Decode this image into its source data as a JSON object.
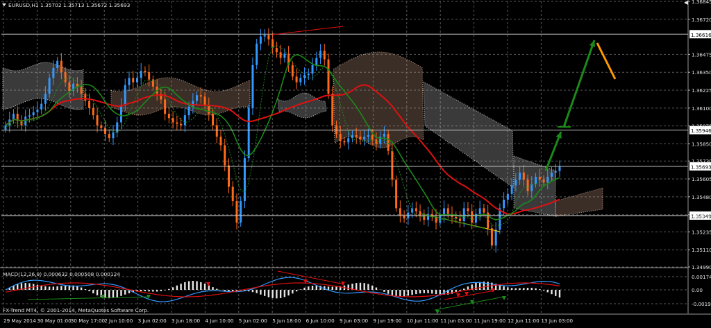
{
  "window": {
    "symbol_label": "EURUSD,H1",
    "ohlc_text": "1.35702 1.35713 1.35672 1.35693",
    "footer_text": "FX-Trend MT4, © 2001-2014, MetaQuotes Software Corp."
  },
  "colors": {
    "background": "#000000",
    "grid": "#5a5a5a",
    "bull_candle": "#3399ff",
    "bear_candle": "#ff6a1a",
    "ma_slow": "#e01010",
    "ma_fast": "#1a8a1a",
    "cloud_a": "#d2a58c",
    "cloud_b": "#cfcfcf",
    "arrow_up": "#1a8a1a",
    "arrow_down": "#ff9a00",
    "sr_line": "#c8c8c8",
    "macd_hist": "#e6e6e6",
    "macd_main": "#3399ff",
    "macd_signal": "#e01010",
    "price_label_bg": "#ffffff"
  },
  "chart_data": {
    "type": "line",
    "title": "EURUSD,H1",
    "y_axis": {
      "range": [
        1.3499,
        1.36845
      ],
      "tick_labels": [
        "1.36845",
        "1.36720",
        "1.36475",
        "1.36350",
        "1.36225",
        "1.36100",
        "1.35975",
        "1.35850",
        "1.35730",
        "1.35605",
        "1.35480",
        "1.35355",
        "1.35235",
        "1.35110",
        "1.34990"
      ]
    },
    "x_axis": {
      "tick_labels": [
        "29 May 2014",
        "30 May 01:00",
        "30 May 17:00",
        "2 Jun 10:00",
        "3 Jun 02:00",
        "3 Jun 18:00",
        "4 Jun 10:00",
        "5 Jun 02:00",
        "5 Jun 18:00",
        "6 Jun 10:00",
        "9 Jun 03:00",
        "9 Jun 19:00",
        "10 Jun 11:00",
        "11 Jun 03:00",
        "11 Jun 19:00",
        "12 Jun 11:00",
        "13 Jun 03:00"
      ]
    },
    "horizontal_levels": [
      {
        "value": 1.36616,
        "label": "1.36616"
      },
      {
        "value": 1.35946,
        "label": "1.35946"
      },
      {
        "value": 1.35693,
        "label": "1.35693"
      },
      {
        "value": 1.35349,
        "label": "1.35349"
      }
    ],
    "close_series": [
      1.3598,
      1.3602,
      1.3606,
      1.3601,
      1.3598,
      1.3604,
      1.3605,
      1.3607,
      1.3609,
      1.3613,
      1.362,
      1.3631,
      1.3638,
      1.3643,
      1.3635,
      1.3628,
      1.3622,
      1.3627,
      1.3625,
      1.362,
      1.3615,
      1.361,
      1.3605,
      1.3598,
      1.3596,
      1.3592,
      1.3589,
      1.3593,
      1.36,
      1.3612,
      1.3626,
      1.3631,
      1.3628,
      1.3631,
      1.3636,
      1.3635,
      1.363,
      1.3625,
      1.362,
      1.3616,
      1.3606,
      1.3603,
      1.36,
      1.3599,
      1.3598,
      1.3605,
      1.3611,
      1.3615,
      1.3619,
      1.3618,
      1.3612,
      1.3606,
      1.3598,
      1.359,
      1.3584,
      1.357,
      1.3555,
      1.3545,
      1.353,
      1.3545,
      1.3575,
      1.361,
      1.364,
      1.3655,
      1.366,
      1.3661,
      1.3658,
      1.3652,
      1.3649,
      1.3645,
      1.3648,
      1.364,
      1.3632,
      1.3628,
      1.3631,
      1.3633,
      1.3634,
      1.364,
      1.3645,
      1.365,
      1.3644,
      1.362,
      1.3598,
      1.3592,
      1.3587,
      1.3586,
      1.3589,
      1.3591,
      1.359,
      1.3588,
      1.359,
      1.3591,
      1.3588,
      1.3585,
      1.359,
      1.3592,
      1.358,
      1.356,
      1.354,
      1.3535,
      1.3533,
      1.3537,
      1.354,
      1.3538,
      1.3535,
      1.3532,
      1.3536,
      1.3534,
      1.353,
      1.3535,
      1.354,
      1.3536,
      1.3534,
      1.3533,
      1.3531,
      1.354,
      1.3538,
      1.353,
      1.3536,
      1.354,
      1.3537,
      1.3526,
      1.3514,
      1.3525,
      1.354,
      1.3546,
      1.355,
      1.3556,
      1.356,
      1.3565,
      1.356,
      1.3552,
      1.3557,
      1.3562,
      1.356,
      1.3558,
      1.3562,
      1.3565,
      1.3566,
      1.3569
    ],
    "indicator": {
      "label": "MACD(12,26,9) 0.000632 0.000508 0.000124",
      "y_tick_labels": [
        "0.00174",
        "0.00",
        "-0.00190"
      ]
    },
    "grid": true
  }
}
